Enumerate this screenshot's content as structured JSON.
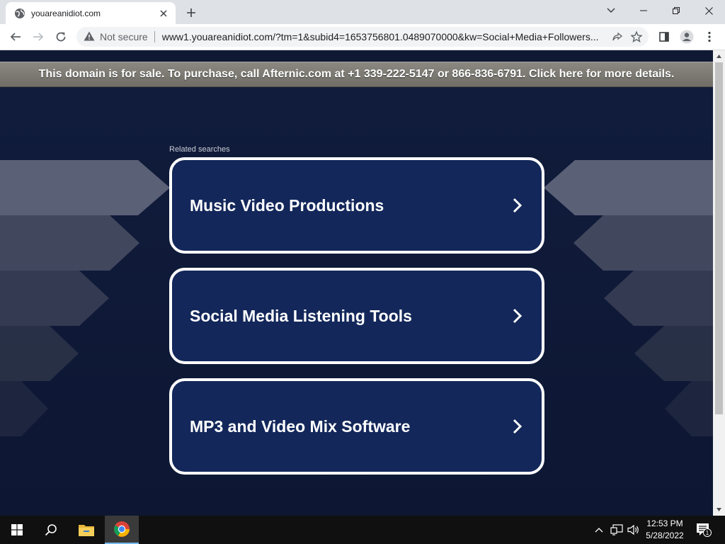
{
  "browser": {
    "tab": {
      "title": "youareanidiot.com"
    },
    "security_label": "Not secure",
    "url": "www1.youareanidiot.com/?tm=1&subid4=1653756801.0489070000&kw=Social+Media+Followers..."
  },
  "page": {
    "banner": "This domain is for sale. To purchase, call Afternic.com at +1 339-222-5147 or 866-836-6791. Click here for more details.",
    "related_label": "Related searches",
    "results": [
      {
        "label": "Music Video Productions"
      },
      {
        "label": "Social Media Listening Tools"
      },
      {
        "label": "MP3 and Video Mix Software"
      }
    ]
  },
  "taskbar": {
    "time": "12:53 PM",
    "date": "5/28/2022",
    "notification_count": "1"
  },
  "colors": {
    "page_background": "#0f1934",
    "card_background": "#13275a",
    "banner_background": "#7d7b74"
  }
}
